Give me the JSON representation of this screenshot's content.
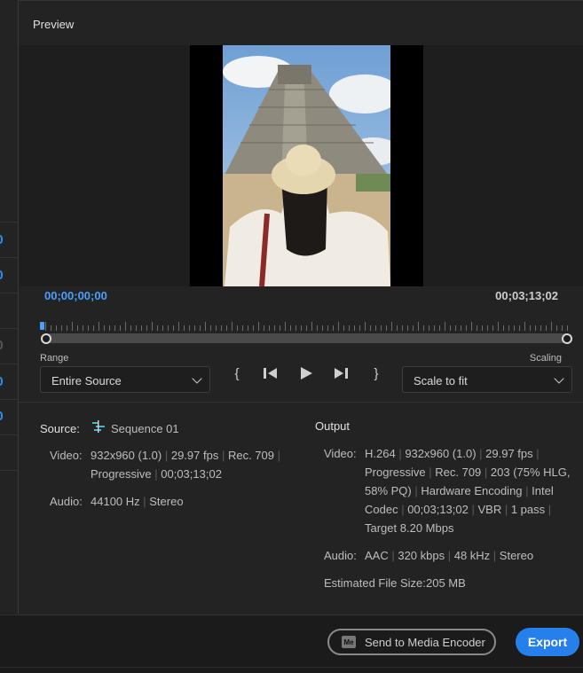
{
  "preview": {
    "title": "Preview"
  },
  "timecode": {
    "start": "00;00;00;00",
    "end": "00;03;13;02"
  },
  "controls": {
    "range_label": "Range",
    "range_value": "Entire Source",
    "scaling_label": "Scaling",
    "scaling_value": "Scale to fit",
    "in_mark": "{",
    "out_mark": "}"
  },
  "source": {
    "label": "Source:",
    "sequence_name": "Sequence 01",
    "video_label": "Video:",
    "video_line1": [
      "932x960 (1.0)",
      "29.97 fps",
      "Rec. 709"
    ],
    "video_line2": [
      "Progressive",
      "00;03;13;02"
    ],
    "audio_label": "Audio:",
    "audio_value": [
      "44100 Hz",
      "Stereo"
    ]
  },
  "output": {
    "title": "Output",
    "video_label": "Video:",
    "video_lines": [
      [
        "H.264",
        "932x960 (1.0)",
        "29.97 fps"
      ],
      [
        "Progressive",
        "Rec. 709",
        "203 (75% HLG,"
      ],
      [
        "58% PQ)",
        "Hardware Encoding",
        "Intel"
      ],
      [
        "Codec",
        "00;03;13;02",
        "VBR",
        "1 pass"
      ],
      [
        "Target 8.20 Mbps"
      ]
    ],
    "audio_label": "Audio:",
    "audio_value": [
      "AAC",
      "320 kbps",
      "48 kHz",
      "Stereo"
    ],
    "size_label": "Estimated File Size:",
    "size_value": "205 MB"
  },
  "footer": {
    "send_button": "Send to Media Encoder",
    "me_icon_text": "Me",
    "export_button": "Export"
  }
}
